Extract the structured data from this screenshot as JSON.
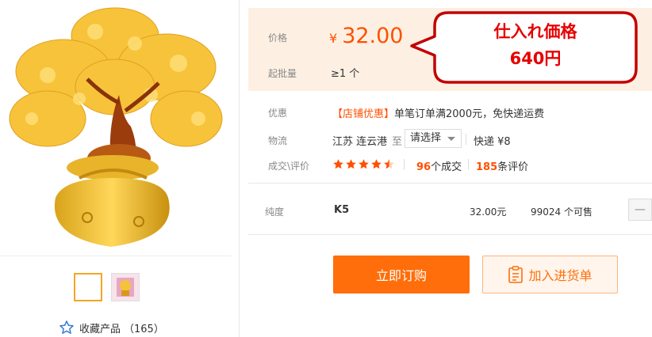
{
  "gallery": {
    "favorite_label": "收藏产品",
    "favorite_count": "（165）"
  },
  "price": {
    "label": "价格",
    "currency": "¥",
    "value": "32.00",
    "moq_label": "起批量",
    "moq_value": "≥1 个"
  },
  "callout": {
    "line1": "仕入れ価格",
    "line2": "640円"
  },
  "promo": {
    "label": "优惠",
    "tag": "【店铺优惠】",
    "text": "单笔订单满2000元，免快递运费"
  },
  "logistics": {
    "label": "物流",
    "origin": "江苏 连云港",
    "to": "至",
    "select_value": "请选择",
    "express": "快递 ¥8"
  },
  "deals": {
    "label": "成交\\评价",
    "rating": 4.5,
    "deals_count": "96",
    "deals_suffix": "个成交",
    "reviews_count": "185",
    "reviews_suffix": "条评价"
  },
  "sku": {
    "label": "纯度",
    "name": "K5",
    "price": "32.00元",
    "stock": "99024 个可售",
    "minus": "—"
  },
  "actions": {
    "buy_label": "立即订购",
    "cart_label": "加入进货单"
  },
  "colors": {
    "accent": "#ff5000",
    "price_bg": "#fdf0e3",
    "callout_red": "#e60000"
  }
}
